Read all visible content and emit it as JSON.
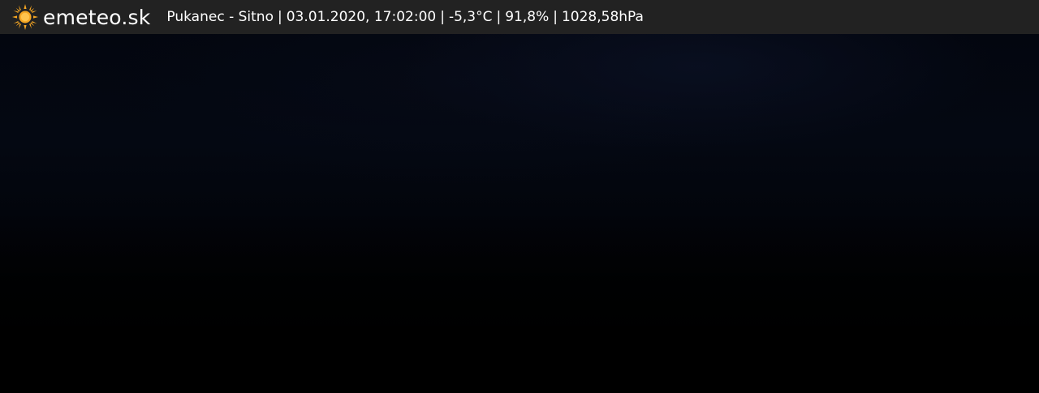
{
  "brand": {
    "name": "emeteo.sk",
    "icon": "sun-icon",
    "icon_color": "#f5a623"
  },
  "caption": {
    "location": "Pukanec - Sitno",
    "datetime": "03.01.2020, 17:02:00",
    "temperature": "-5,3°C",
    "humidity": "91,8%",
    "pressure": "1028,58hPa"
  },
  "colors": {
    "bar_background": "#222222",
    "text": "#ffffff",
    "sky": "#03060f"
  }
}
